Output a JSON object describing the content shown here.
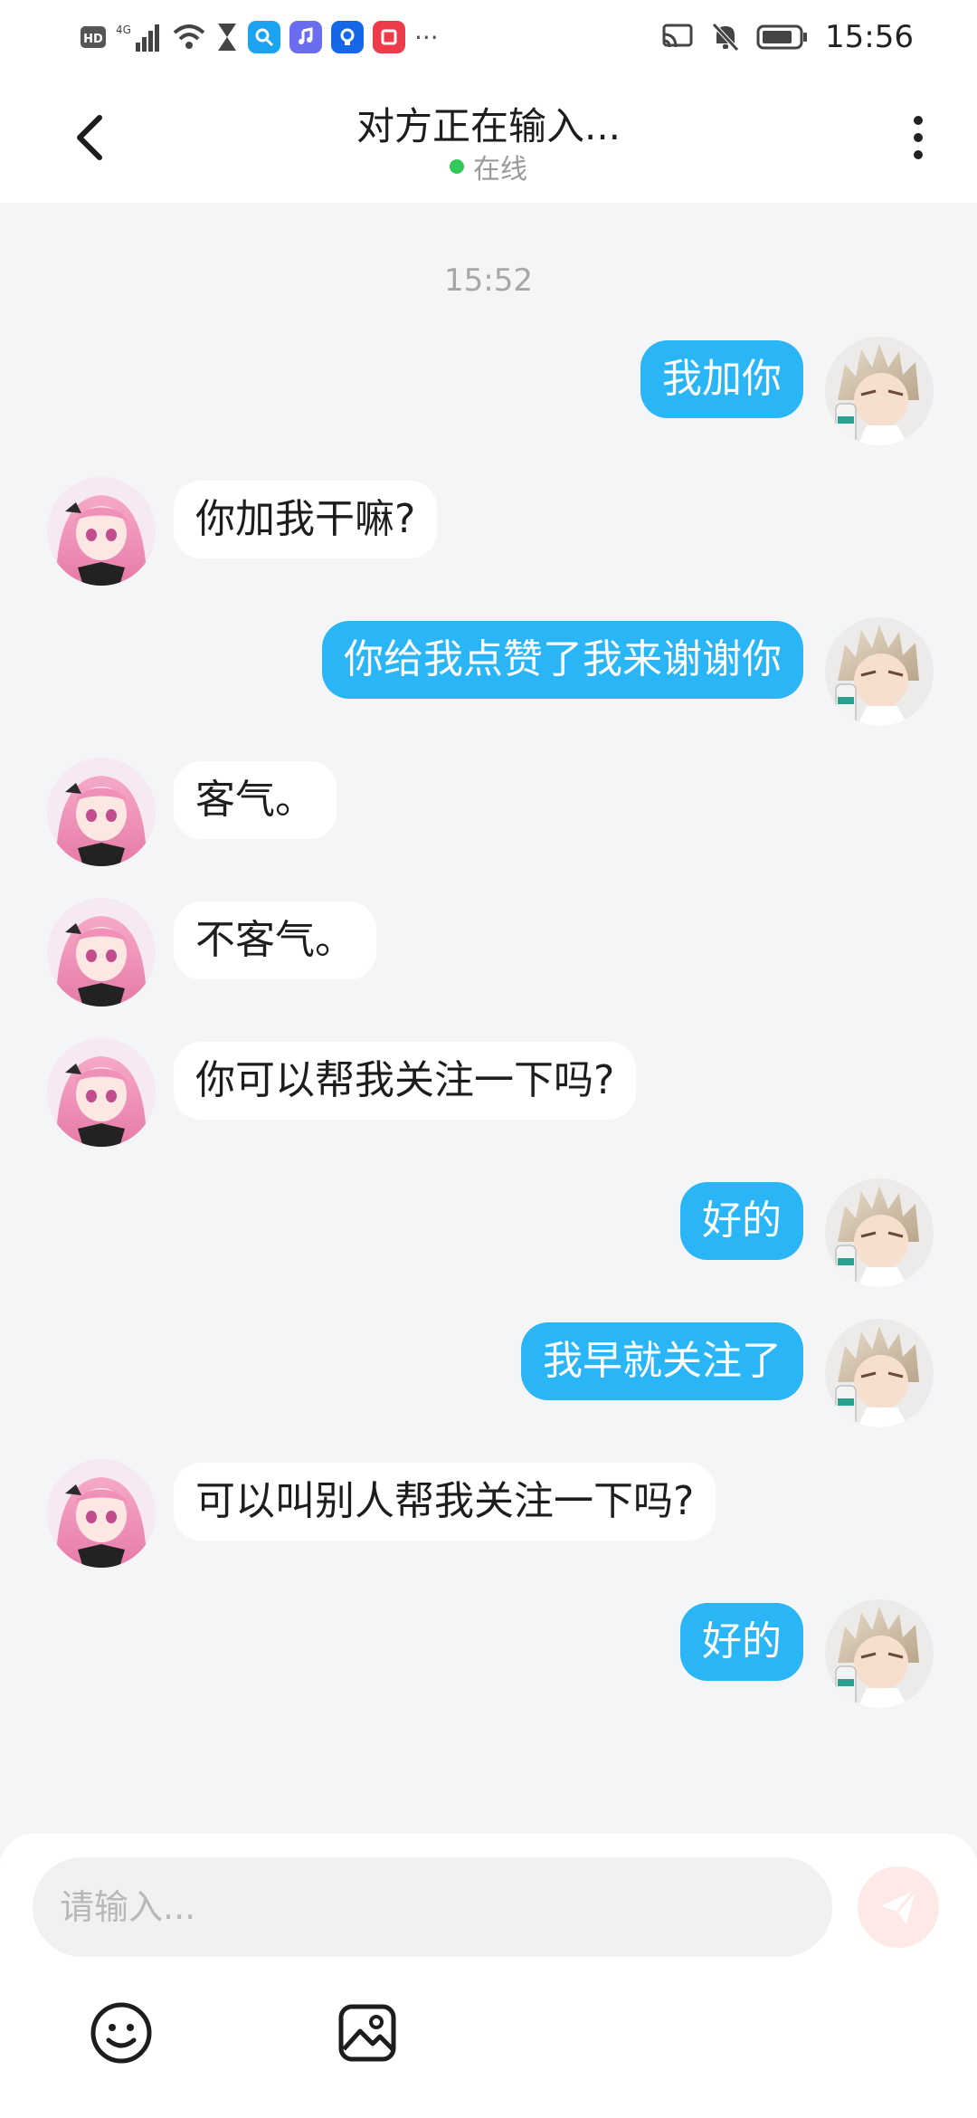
{
  "status_bar": {
    "time": "15:56",
    "network": "4G",
    "hd": "HD"
  },
  "header": {
    "title": "对方正在输入...",
    "status": "在线"
  },
  "chat": {
    "timestamp": "15:52",
    "messages": [
      {
        "side": "out",
        "text": "我加你"
      },
      {
        "side": "in",
        "text": "你加我干嘛?"
      },
      {
        "side": "out",
        "text": "你给我点赞了我来谢谢你"
      },
      {
        "side": "in",
        "text": "客气。"
      },
      {
        "side": "in",
        "text": "不客气。"
      },
      {
        "side": "in",
        "text": "你可以帮我关注一下吗?"
      },
      {
        "side": "out",
        "text": "好的"
      },
      {
        "side": "out",
        "text": "我早就关注了"
      },
      {
        "side": "in",
        "text": "可以叫别人帮我关注一下吗?"
      },
      {
        "side": "out",
        "text": "好的"
      }
    ]
  },
  "composer": {
    "placeholder": "请输入...",
    "value": ""
  },
  "colors": {
    "outgoing_bubble": "#29b5f6",
    "incoming_bubble": "#ffffff",
    "online": "#34c759",
    "send_button": "#fde9e6"
  },
  "icons": {
    "back": "back-arrow-icon",
    "more": "more-vertical-icon",
    "send": "send-icon",
    "emoji": "emoji-icon",
    "image": "image-icon"
  }
}
